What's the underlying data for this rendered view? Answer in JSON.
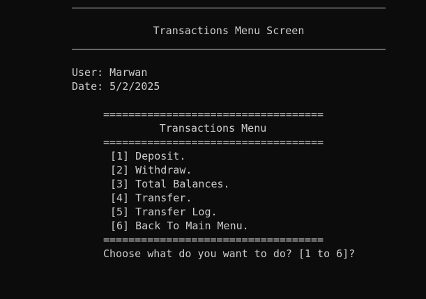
{
  "screen": {
    "title": "Transactions Menu Screen"
  },
  "session": {
    "user_line": "User: Marwan",
    "date_line": "Date: 5/2/2025"
  },
  "menu": {
    "separator": "===================================",
    "title": "Transactions Menu",
    "items": [
      "[1] Deposit.",
      "[2] Withdraw.",
      "[3] Total Balances.",
      "[4] Transfer.",
      "[5] Transfer Log.",
      "[6] Back To Main Menu."
    ],
    "prompt": "Choose what do you want to do? [1 to 6]?"
  },
  "colors": {
    "background": "#0c0c0c",
    "foreground": "#cccccc"
  }
}
